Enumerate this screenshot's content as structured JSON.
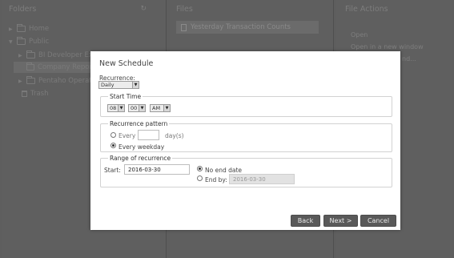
{
  "background": {
    "folders": {
      "title": "Folders",
      "refresh_icon": "refresh-icon",
      "items": [
        {
          "label": "Home",
          "icon": "folder-icon"
        },
        {
          "label": "Public",
          "icon": "folder-icon"
        },
        {
          "label": "BI Developer Ex",
          "icon": "folder-icon"
        },
        {
          "label": "Company Repor",
          "icon": "folder-icon"
        },
        {
          "label": "Pentaho Operat",
          "icon": "folder-icon"
        },
        {
          "label": "Trash",
          "icon": "trash-icon"
        }
      ]
    },
    "files": {
      "title": "Files",
      "items": [
        {
          "label": "Yesterday Transaction Counts",
          "icon": "document-icon"
        }
      ]
    },
    "actions": {
      "title": "File Actions",
      "items": [
        "Open",
        "Open in a new window",
        "nd..."
      ]
    }
  },
  "dialog": {
    "title": "New Schedule",
    "recurrence_label": "Recurrence:",
    "recurrence_value": "Daily",
    "start_time": {
      "legend": "Start Time",
      "hour": "08",
      "minute": "00",
      "ampm": "AM"
    },
    "pattern": {
      "legend": "Recurrence pattern",
      "every_label": "Every",
      "days_value": "",
      "days_suffix": "day(s)",
      "weekday_label": "Every weekday",
      "selected": "every-weekday"
    },
    "range": {
      "legend": "Range of recurrence",
      "start_label": "Start:",
      "start_value": "2016-03-30",
      "no_end_label": "No end date",
      "end_by_label": "End by:",
      "end_by_value": "2016-03-30",
      "selected": "no-end-date"
    },
    "buttons": {
      "back": "Back",
      "next": "Next >",
      "cancel": "Cancel"
    }
  }
}
